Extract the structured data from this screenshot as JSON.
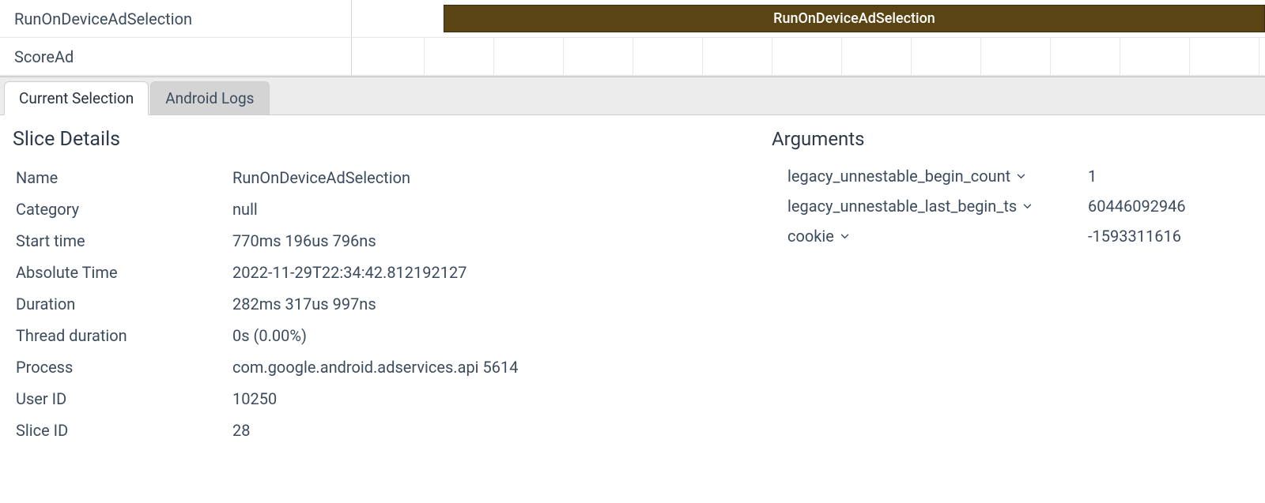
{
  "tracks": {
    "row1_label": "RunOnDeviceAdSelection",
    "row1_slice": "RunOnDeviceAdSelection",
    "row2_label": "ScoreAd"
  },
  "tabs": {
    "current_selection": "Current Selection",
    "android_logs": "Android Logs"
  },
  "slice_details": {
    "heading": "Slice Details",
    "rows": {
      "name_k": "Name",
      "name_v": "RunOnDeviceAdSelection",
      "category_k": "Category",
      "category_v": "null",
      "start_time_k": "Start time",
      "start_time_v": "770ms 196us 796ns",
      "absolute_time_k": "Absolute Time",
      "absolute_time_v": "2022-11-29T22:34:42.812192127",
      "duration_k": "Duration",
      "duration_v": "282ms 317us 997ns",
      "thread_duration_k": "Thread duration",
      "thread_duration_v": "0s (0.00%)",
      "process_k": "Process",
      "process_v": "com.google.android.adservices.api 5614",
      "user_id_k": "User ID",
      "user_id_v": "10250",
      "slice_id_k": "Slice ID",
      "slice_id_v": "28"
    }
  },
  "arguments": {
    "heading": "Arguments",
    "rows": {
      "r1_k": "legacy_unnestable_begin_count",
      "r1_v": "1",
      "r2_k": "legacy_unnestable_last_begin_ts",
      "r2_v": "60446092946",
      "r3_k": "cookie",
      "r3_v": "-1593311616"
    }
  }
}
